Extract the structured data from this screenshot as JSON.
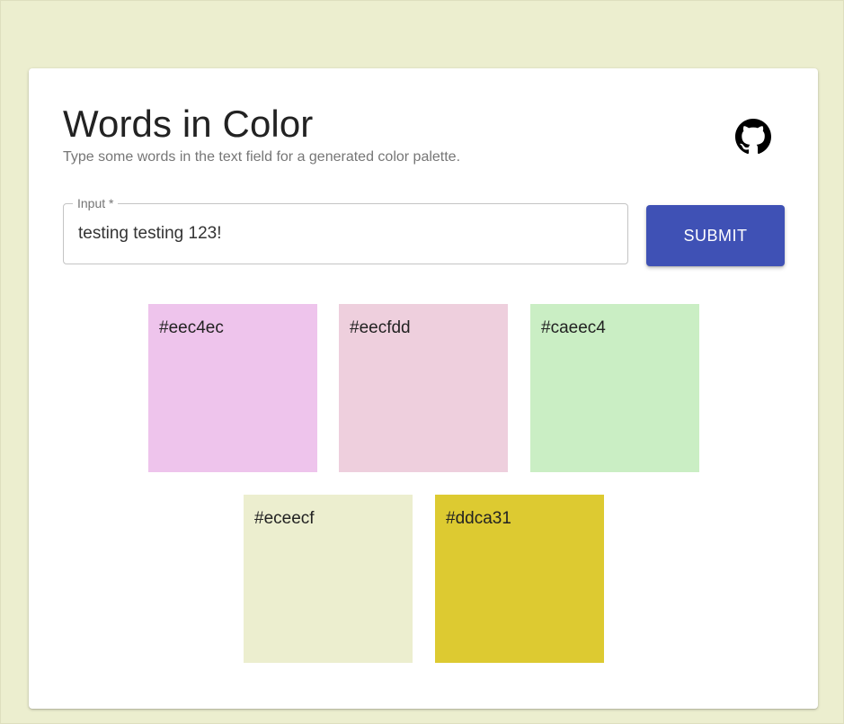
{
  "app": {
    "title": "Words in Color",
    "subtitle": "Type some words in the text field for a generated color palette.",
    "github_icon": "github-icon"
  },
  "form": {
    "input_label": "Input *",
    "input_value": "testing testing 123!",
    "submit_label": "SUBMIT"
  },
  "palette": [
    {
      "hex": "#eec4ec",
      "color": "#eec4ec"
    },
    {
      "hex": "#eecfdd",
      "color": "#eecfdd"
    },
    {
      "hex": "#caeec4",
      "color": "#caeec4"
    },
    {
      "hex": "#eceecf",
      "color": "#eceecf"
    },
    {
      "hex": "#ddca31",
      "color": "#ddca31"
    }
  ],
  "colors": {
    "page_background": "#eceecf",
    "card_background": "#ffffff",
    "accent": "#3f51b5"
  }
}
